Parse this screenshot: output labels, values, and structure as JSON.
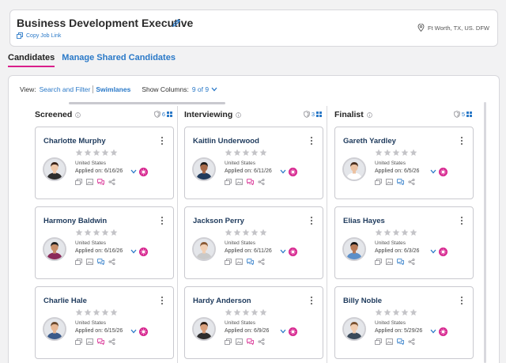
{
  "job": {
    "title": "Business Development Executive",
    "copy_link_label": "Copy Job Link",
    "location": "Ft Worth, TX, US. DFW"
  },
  "tabs": [
    {
      "label": "Candidates",
      "active": true
    },
    {
      "label": "Manage Shared Candidates",
      "active": false
    }
  ],
  "view_bar": {
    "view_label": "View:",
    "search_filter_label": "Search and Filter",
    "swimlanes_label": "Swimlanes",
    "show_columns_label": "Show Columns:",
    "show_columns_value": "9 of 9"
  },
  "colors": {
    "accent_pink": "#d6208c",
    "link_blue": "#2a79c8",
    "name_navy": "#1e3a5c"
  },
  "columns": [
    {
      "name": "Screened",
      "count": "6",
      "cards": [
        {
          "name": "Charlotte Murphy",
          "country": "United States",
          "applied": "Applied on: 6/16/26",
          "rating": 0,
          "message_active": true
        },
        {
          "name": "Harmony Baldwin",
          "country": "United States",
          "applied": "Applied on: 6/16/26",
          "rating": 0,
          "message_active": false
        },
        {
          "name": "Charlie Hale",
          "country": "United States",
          "applied": "Applied on: 6/15/26",
          "rating": 0,
          "message_active": true
        }
      ]
    },
    {
      "name": "Interviewing",
      "count": "3",
      "cards": [
        {
          "name": "Kaitlin Underwood",
          "country": "United States",
          "applied": "Applied on: 6/11/26",
          "rating": 0,
          "message_active": true
        },
        {
          "name": "Jackson Perry",
          "country": "United States",
          "applied": "Applied on: 6/11/26",
          "rating": 0,
          "message_active": false
        },
        {
          "name": "Hardy Anderson",
          "country": "United States",
          "applied": "Applied on: 6/9/26",
          "rating": 0,
          "message_active": true
        }
      ]
    },
    {
      "name": "Finalist",
      "count": "5",
      "cards": [
        {
          "name": "Gareth Yardley",
          "country": "United States",
          "applied": "Applied on: 6/5/26",
          "rating": 0,
          "message_active": false
        },
        {
          "name": "Elias Hayes",
          "country": "United States",
          "applied": "Applied on: 6/3/26",
          "rating": 0,
          "message_active": false
        },
        {
          "name": "Billy Noble",
          "country": "United States",
          "applied": "Applied on: 5/29/26",
          "rating": 0,
          "message_active": false
        }
      ]
    }
  ]
}
